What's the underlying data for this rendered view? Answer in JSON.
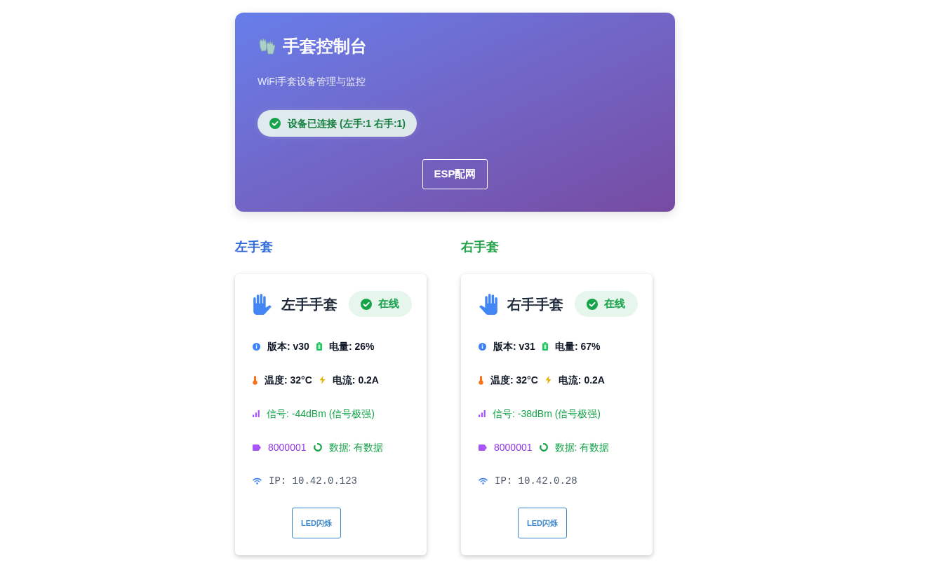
{
  "header": {
    "title": "手套控制台",
    "subtitle": "WiFi手套设备管理与监控",
    "status": {
      "text": "设备已连接 (左手:1 右手:1)",
      "connected": true
    },
    "button": "ESP配网"
  },
  "gloves": [
    {
      "heading": "左手套",
      "color": "#2f6ad8",
      "kind": "left",
      "name": "左手手套",
      "status": {
        "label": "在线",
        "online": true
      },
      "version": "版本: v30",
      "battery": "电量: 26%",
      "temperature": "温度: 32°C",
      "current": "电流: 0.2A",
      "signal": "信号: -44dBm (信号极强)",
      "id": "8000001",
      "data": "数据: 有数据",
      "ip": "IP: 10.42.0.123",
      "button": "LED闪烁"
    },
    {
      "heading": "右手套",
      "color": "#23a148",
      "kind": "right",
      "name": "右手手套",
      "status": {
        "label": "在线",
        "online": true
      },
      "version": "版本: v31",
      "battery": "电量: 67%",
      "temperature": "温度: 32°C",
      "current": "电流: 0.2A",
      "signal": "信号: -38dBm (信号极强)",
      "id": "8000001",
      "data": "数据: 有数据",
      "ip": "IP: 10.42.0.28",
      "button": "LED闪烁"
    }
  ]
}
